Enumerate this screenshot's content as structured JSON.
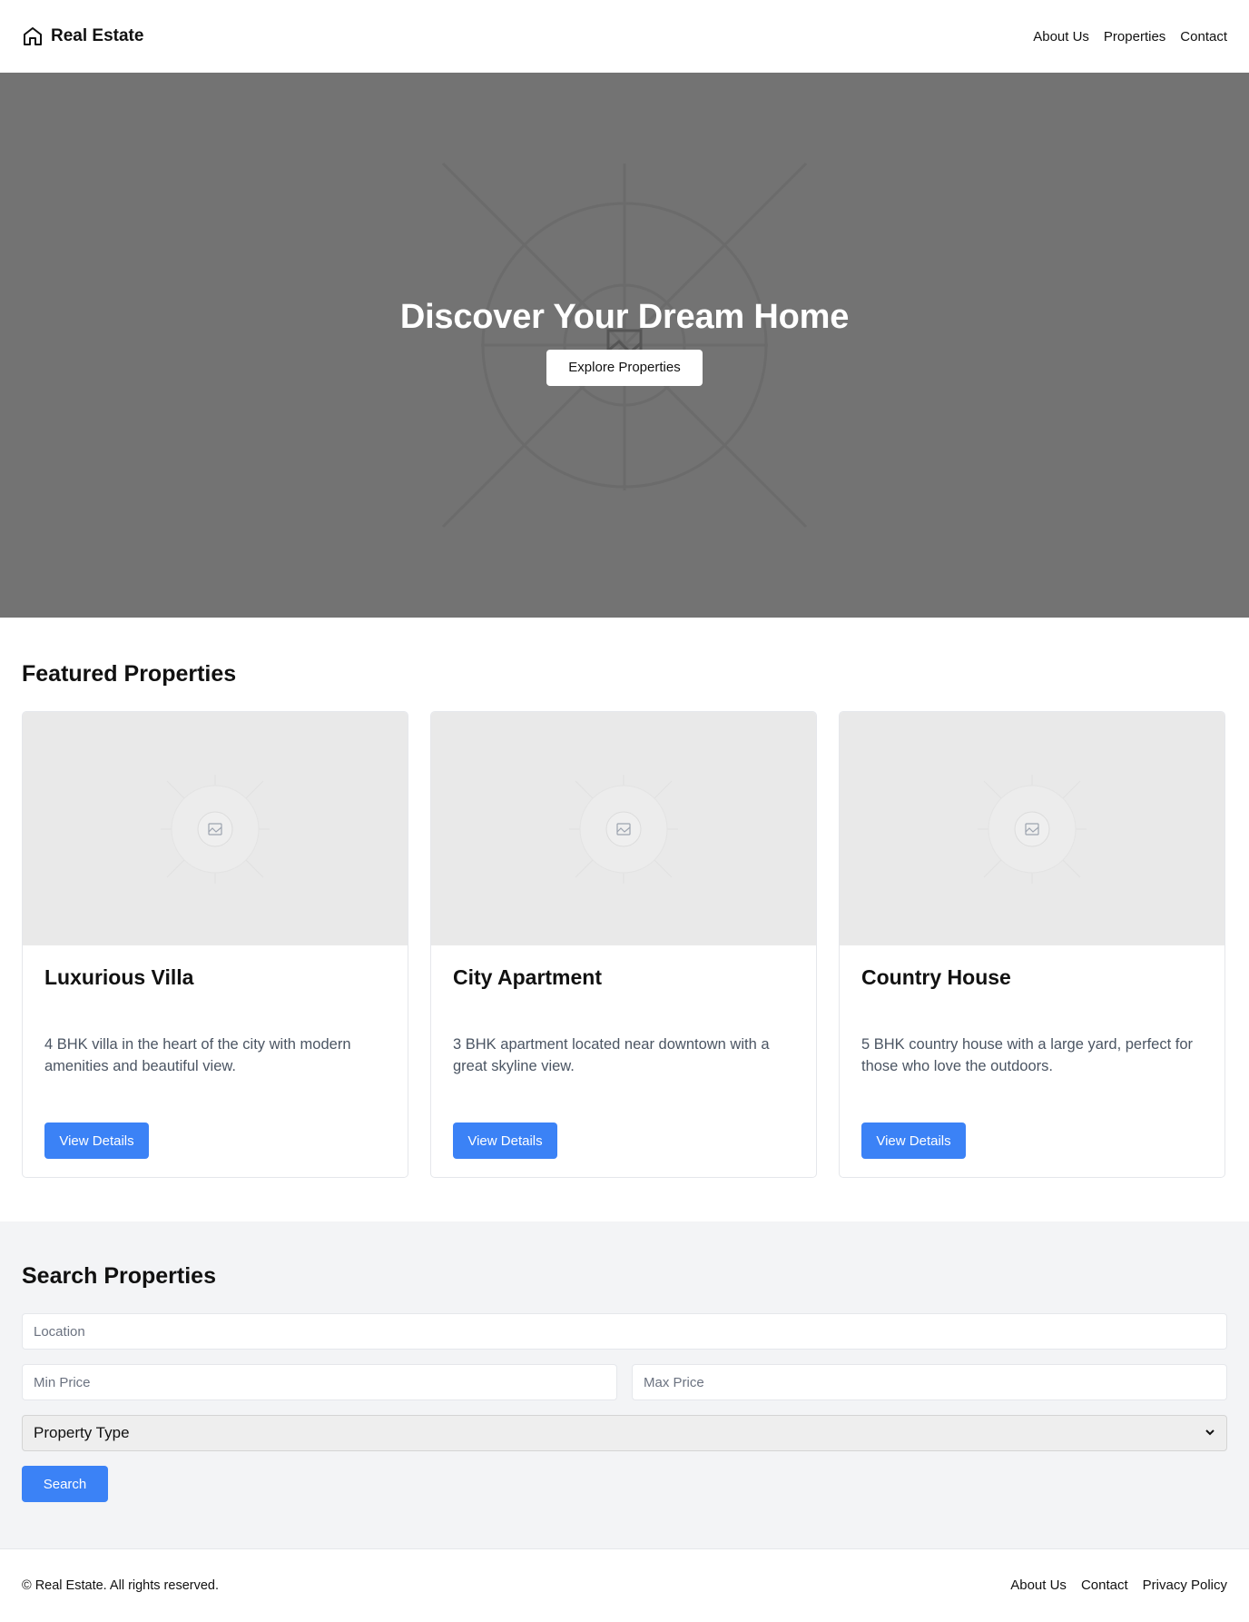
{
  "header": {
    "brand": "Real Estate",
    "nav": [
      "About Us",
      "Properties",
      "Contact"
    ]
  },
  "hero": {
    "title": "Discover Your Dream Home",
    "button": "Explore Properties"
  },
  "featured": {
    "title": "Featured Properties",
    "cards": [
      {
        "title": "Luxurious Villa",
        "description": "4 BHK villa in the heart of the city with modern amenities and beautiful view.",
        "button": "View Details"
      },
      {
        "title": "City Apartment",
        "description": "3 BHK apartment located near downtown with a great skyline view.",
        "button": "View Details"
      },
      {
        "title": "Country House",
        "description": "5 BHK country house with a large yard, perfect for those who love the outdoors.",
        "button": "View Details"
      }
    ]
  },
  "search": {
    "title": "Search Properties",
    "location_placeholder": "Location",
    "min_price_placeholder": "Min Price",
    "max_price_placeholder": "Max Price",
    "property_type": "Property Type",
    "button": "Search"
  },
  "footer": {
    "copyright": "© Real Estate. All rights reserved.",
    "links": [
      "About Us",
      "Contact",
      "Privacy Policy"
    ]
  },
  "colors": {
    "accent": "#3b82f6",
    "hero_bg": "#737373",
    "search_bg": "#f3f4f6"
  }
}
